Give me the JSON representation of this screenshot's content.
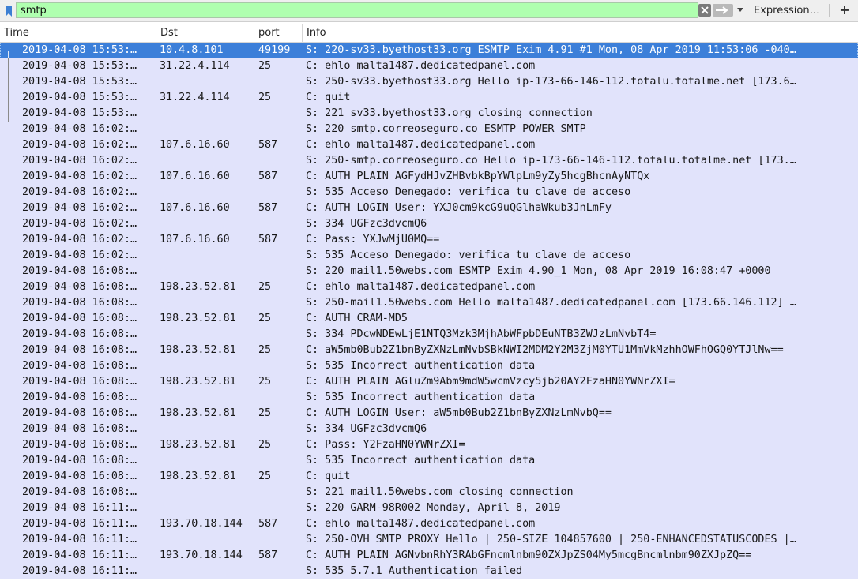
{
  "filter": {
    "value": "smtp",
    "expression_label": "Expression…",
    "add_label": "+",
    "colors": {
      "filter_valid_bg": "#afffaf",
      "selected_row": "#3c7fd9",
      "smtp_row": "#e1e3fb"
    }
  },
  "columns": [
    "Time",
    "Dst",
    "port",
    "Info"
  ],
  "rows": [
    {
      "time": "2019-04-08 15:53:…",
      "dst": "10.4.8.101",
      "port": "49199",
      "info": "S: 220-sv33.byethost33.org ESMTP Exim 4.91 #1 Mon, 08 Apr 2019 11:53:06 -040…"
    },
    {
      "time": "2019-04-08 15:53:…",
      "dst": "31.22.4.114",
      "port": "25",
      "info": "C: ehlo malta1487.dedicatedpanel.com"
    },
    {
      "time": "2019-04-08 15:53:…",
      "dst": "",
      "port": "",
      "info": "S: 250-sv33.byethost33.org Hello ip-173-66-146-112.totalu.totalme.net [173.6…"
    },
    {
      "time": "2019-04-08 15:53:…",
      "dst": "31.22.4.114",
      "port": "25",
      "info": "C: quit"
    },
    {
      "time": "2019-04-08 15:53:…",
      "dst": "",
      "port": "",
      "info": "S: 221 sv33.byethost33.org closing connection"
    },
    {
      "time": "2019-04-08 16:02:…",
      "dst": "",
      "port": "",
      "info": "S: 220 smtp.correoseguro.co ESMTP POWER SMTP"
    },
    {
      "time": "2019-04-08 16:02:…",
      "dst": "107.6.16.60",
      "port": "587",
      "info": "C: ehlo malta1487.dedicatedpanel.com"
    },
    {
      "time": "2019-04-08 16:02:…",
      "dst": "",
      "port": "",
      "info": "S: 250-smtp.correoseguro.co Hello ip-173-66-146-112.totalu.totalme.net [173.…"
    },
    {
      "time": "2019-04-08 16:02:…",
      "dst": "107.6.16.60",
      "port": "587",
      "info": "C: AUTH PLAIN AGFydHJvZHBvbkBpYWlpLm9yZy5hcgBhcnAyNTQx"
    },
    {
      "time": "2019-04-08 16:02:…",
      "dst": "",
      "port": "",
      "info": "S: 535 Acceso Denegado: verifica tu clave de acceso"
    },
    {
      "time": "2019-04-08 16:02:…",
      "dst": "107.6.16.60",
      "port": "587",
      "info": "C: AUTH LOGIN User: YXJ0cm9kcG9uQGlhaWkub3JnLmFy"
    },
    {
      "time": "2019-04-08 16:02:…",
      "dst": "",
      "port": "",
      "info": "S: 334 UGFzc3dvcmQ6"
    },
    {
      "time": "2019-04-08 16:02:…",
      "dst": "107.6.16.60",
      "port": "587",
      "info": "C: Pass: YXJwMjU0MQ=="
    },
    {
      "time": "2019-04-08 16:02:…",
      "dst": "",
      "port": "",
      "info": "S: 535 Acceso Denegado: verifica tu clave de acceso"
    },
    {
      "time": "2019-04-08 16:08:…",
      "dst": "",
      "port": "",
      "info": "S: 220 mail1.50webs.com ESMTP Exim 4.90_1 Mon, 08 Apr 2019 16:08:47 +0000"
    },
    {
      "time": "2019-04-08 16:08:…",
      "dst": "198.23.52.81",
      "port": "25",
      "info": "C: ehlo malta1487.dedicatedpanel.com"
    },
    {
      "time": "2019-04-08 16:08:…",
      "dst": "",
      "port": "",
      "info": "S: 250-mail1.50webs.com Hello malta1487.dedicatedpanel.com [173.66.146.112] …"
    },
    {
      "time": "2019-04-08 16:08:…",
      "dst": "198.23.52.81",
      "port": "25",
      "info": "C: AUTH CRAM-MD5"
    },
    {
      "time": "2019-04-08 16:08:…",
      "dst": "",
      "port": "",
      "info": "S: 334 PDcwNDEwLjE1NTQ3Mzk3MjhAbWFpbDEuNTB3ZWJzLmNvbT4="
    },
    {
      "time": "2019-04-08 16:08:…",
      "dst": "198.23.52.81",
      "port": "25",
      "info": "C: aW5mb0Bub2Z1bnByZXNzLmNvbSBkNWI2MDM2Y2M3ZjM0YTU1MmVkMzhhOWFhOGQ0YTJlNw=="
    },
    {
      "time": "2019-04-08 16:08:…",
      "dst": "",
      "port": "",
      "info": "S: 535 Incorrect authentication data"
    },
    {
      "time": "2019-04-08 16:08:…",
      "dst": "198.23.52.81",
      "port": "25",
      "info": "C: AUTH PLAIN AGluZm9Abm9mdW5wcmVzcy5jb20AY2FzaHN0YWNrZXI="
    },
    {
      "time": "2019-04-08 16:08:…",
      "dst": "",
      "port": "",
      "info": "S: 535 Incorrect authentication data"
    },
    {
      "time": "2019-04-08 16:08:…",
      "dst": "198.23.52.81",
      "port": "25",
      "info": "C: AUTH LOGIN User: aW5mb0Bub2Z1bnByZXNzLmNvbQ=="
    },
    {
      "time": "2019-04-08 16:08:…",
      "dst": "",
      "port": "",
      "info": "S: 334 UGFzc3dvcmQ6"
    },
    {
      "time": "2019-04-08 16:08:…",
      "dst": "198.23.52.81",
      "port": "25",
      "info": "C: Pass: Y2FzaHN0YWNrZXI="
    },
    {
      "time": "2019-04-08 16:08:…",
      "dst": "",
      "port": "",
      "info": "S: 535 Incorrect authentication data"
    },
    {
      "time": "2019-04-08 16:08:…",
      "dst": "198.23.52.81",
      "port": "25",
      "info": "C: quit"
    },
    {
      "time": "2019-04-08 16:08:…",
      "dst": "",
      "port": "",
      "info": "S: 221 mail1.50webs.com closing connection"
    },
    {
      "time": "2019-04-08 16:11:…",
      "dst": "",
      "port": "",
      "info": "S: 220 GARM-98R002 Monday, April 8, 2019"
    },
    {
      "time": "2019-04-08 16:11:…",
      "dst": "193.70.18.144",
      "port": "587",
      "info": "C: ehlo malta1487.dedicatedpanel.com"
    },
    {
      "time": "2019-04-08 16:11:…",
      "dst": "",
      "port": "",
      "info": "S: 250-OVH SMTP PROXY Hello | 250-SIZE 104857600 | 250-ENHANCEDSTATUSCODES |…"
    },
    {
      "time": "2019-04-08 16:11:…",
      "dst": "193.70.18.144",
      "port": "587",
      "info": "C: AUTH PLAIN AGNvbnRhY3RAbGFncmlnbm90ZXJpZS04My5mcgBncmlnbm90ZXJpZQ=="
    },
    {
      "time": "2019-04-08 16:11:…",
      "dst": "",
      "port": "",
      "info": "S: 535 5.7.1 Authentication failed"
    }
  ]
}
